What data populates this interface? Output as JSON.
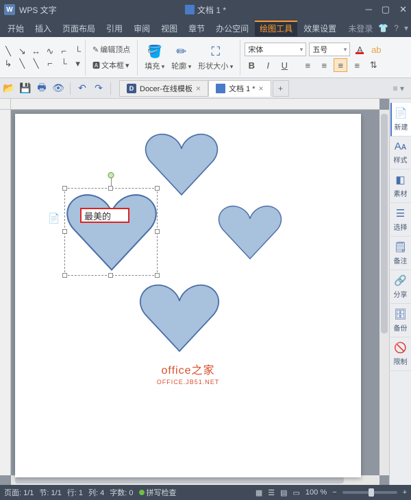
{
  "titlebar": {
    "app_name": "WPS 文字",
    "doc_title": "文档 1 *"
  },
  "menubar": {
    "items": [
      "开始",
      "插入",
      "页面布局",
      "引用",
      "审阅",
      "视图",
      "章节",
      "办公空间",
      "绘图工具",
      "效果设置"
    ],
    "active_index": 8,
    "login": "未登录"
  },
  "ribbon": {
    "edit_vertices": "编辑顶点",
    "textbox": "文本框",
    "fill": "填充",
    "outline": "轮廓",
    "shape_size": "形状大小",
    "font_name": "宋体",
    "font_size": "五号"
  },
  "tabs": {
    "t1": "Docer-在线模板",
    "t2": "文档 1 *"
  },
  "sidepanel": {
    "items": [
      "新建",
      "样式",
      "素材",
      "选择",
      "备注",
      "分享",
      "备份",
      "限制"
    ]
  },
  "canvas": {
    "textbox_value": "最美的",
    "watermark_title": "office之家",
    "watermark_sub": "OFFICE.JB51.NET"
  },
  "statusbar": {
    "page": "页面: 1/1",
    "section": "节: 1/1",
    "line": "行: 1",
    "col": "列: 4",
    "chars": "字数: 0",
    "spell": "拼写检查",
    "zoom": "100 %"
  }
}
